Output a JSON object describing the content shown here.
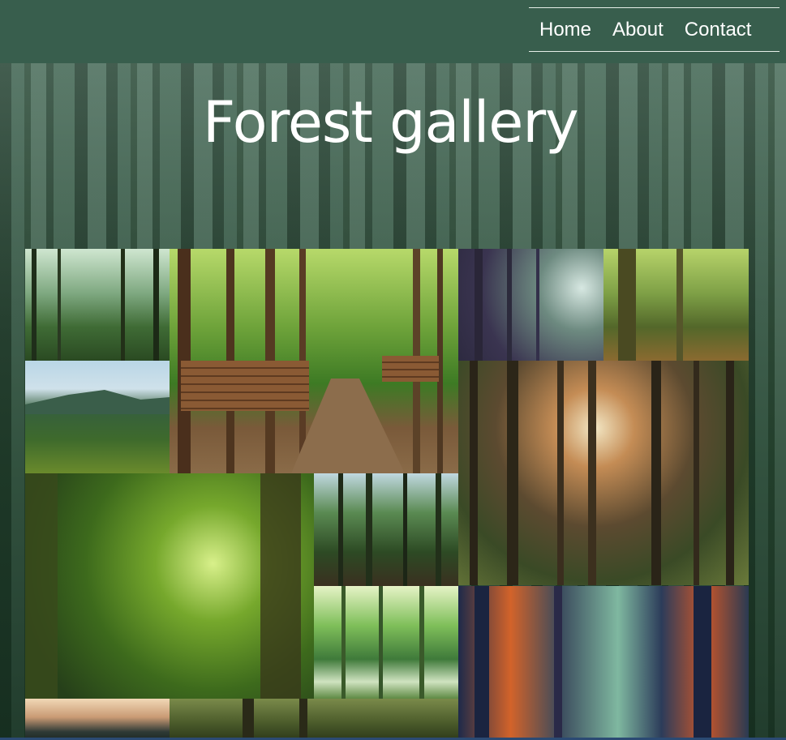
{
  "nav": {
    "items": [
      {
        "label": "Home"
      },
      {
        "label": "About"
      },
      {
        "label": "Contact"
      }
    ]
  },
  "hero": {
    "title": "Forest gallery"
  },
  "gallery": {
    "images": [
      {
        "name": "forest-photo-1"
      },
      {
        "name": "forest-path-logs-photo"
      },
      {
        "name": "misty-forest-photo"
      },
      {
        "name": "old-oak-trees-photo"
      },
      {
        "name": "mountain-forest-photo"
      },
      {
        "name": "sunlit-forest-photo"
      },
      {
        "name": "green-tree-tunnel-photo"
      },
      {
        "name": "dense-forest-photo"
      },
      {
        "name": "bright-green-forest-photo"
      },
      {
        "name": "autumn-forest-photo"
      },
      {
        "name": "sunset-mountain-photo"
      },
      {
        "name": "tree-trunks-photo"
      }
    ]
  }
}
